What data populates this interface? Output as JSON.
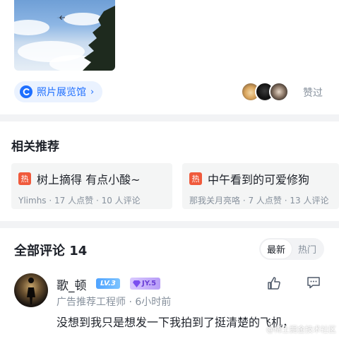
{
  "album_tag": {
    "label": "照片展览馆",
    "chevron": "›",
    "icon": "album-c-icon"
  },
  "likes": {
    "label": "赞过"
  },
  "related": {
    "title": "相关推荐",
    "badge": "热",
    "items": [
      {
        "title": "树上摘得 有点小酸~",
        "author": "Ylimhs",
        "likes": "17 人点赞",
        "comments": "10 人评论"
      },
      {
        "title": "中午看到的可爱修狗",
        "author": "那我关月亮咯",
        "likes": "7 人点赞",
        "comments": "13 人评论"
      }
    ]
  },
  "comments": {
    "title": "全部评论 14",
    "sort": {
      "latest": "最新",
      "hot": "热门"
    },
    "first": {
      "name": "歌_顿",
      "level": "LV.3",
      "jy": "JY.5",
      "role": "广告推荐工程师",
      "time": "6小时前",
      "text": "没想到我只是想发一下我拍到了挺清楚的飞机，"
    }
  },
  "watermark": "@稀土掘金技术社区"
}
